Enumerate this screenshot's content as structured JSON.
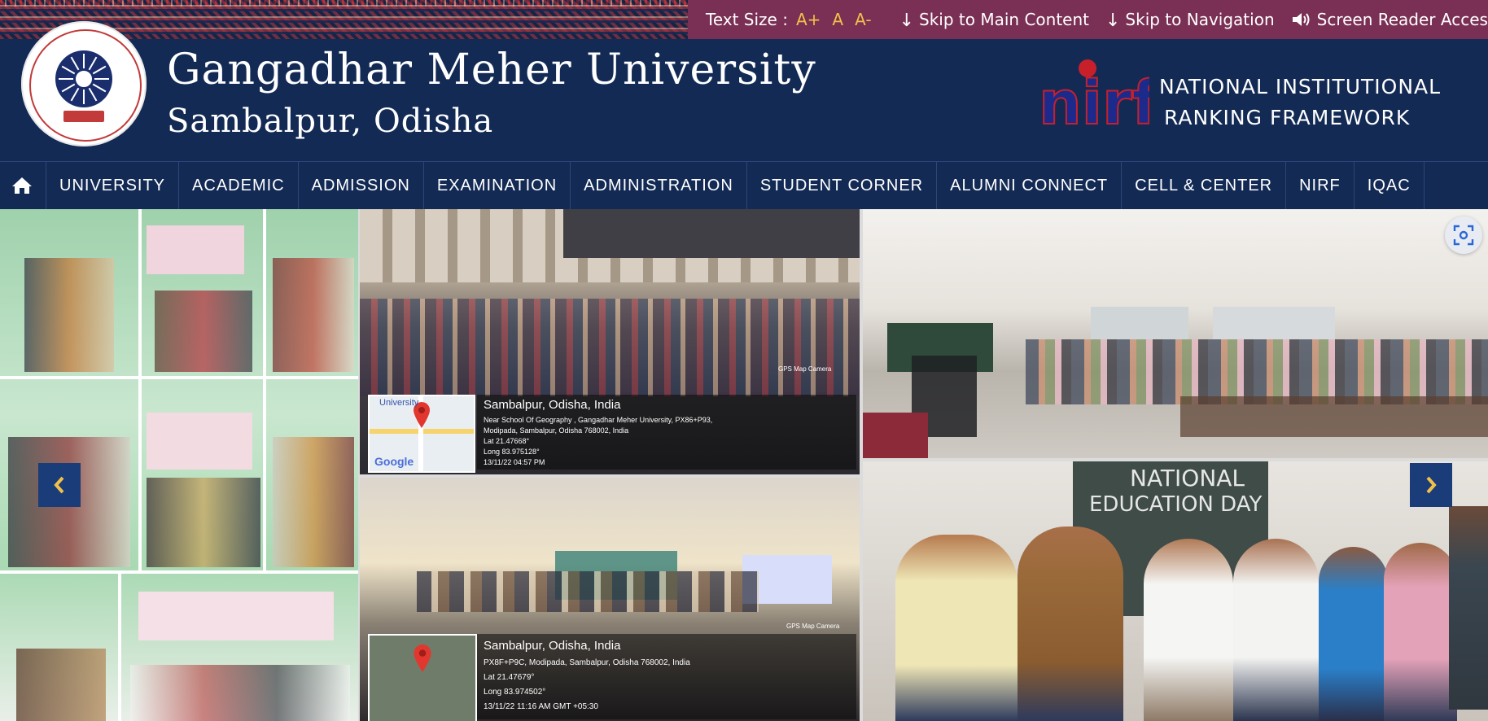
{
  "topbar": {
    "text_size_label": "Text Size :",
    "text_size_buttons": [
      "A+",
      "A",
      "A-"
    ],
    "skip_main": "Skip to Main Content",
    "skip_nav": "Skip to Navigation",
    "screen_reader": "Screen Reader Access"
  },
  "header": {
    "university_name": "Gangadhar Meher University",
    "location": "Sambalpur, Odisha",
    "nirf_line1": "NATIONAL INSTITUTIONAL",
    "nirf_line2": "RANKING FRAMEWORK",
    "nirf_logo_text": "nirf"
  },
  "nav": {
    "items": [
      "UNIVERSITY",
      "ACADEMIC",
      "ADMISSION",
      "EXAMINATION",
      "ADMINISTRATION",
      "STUDENT CORNER",
      "ALUMNI CONNECT",
      "CELL & CENTER",
      "NIRF",
      "IQAC"
    ]
  },
  "slider": {
    "geo_tag_1": {
      "city": "Sambalpur, Odisha, India",
      "addr1": "Near School Of Geography , Gangadhar Meher University, PX86+P93,",
      "addr2": "Modipada, Sambalpur, Odisha 768002, India",
      "lat": "Lat 21.47668°",
      "long": "Long 83.975128°",
      "time": "13/11/22 04:57 PM",
      "camera": "GPS Map Camera"
    },
    "geo_tag_2": {
      "city": "Sambalpur, Odisha, India",
      "addr1": "PX8F+P9C, Modipada, Sambalpur, Odisha 768002, India",
      "lat": "Lat 21.47679°",
      "long": "Long 83.974502°",
      "time": "13/11/22 11:16 AM GMT +05:30",
      "camera": "GPS Map Camera"
    },
    "board_text_line1": "NATIONAL",
    "board_text_line2": "EDUCATION DAY",
    "map_label": "University",
    "map_brand": "Google"
  },
  "colors": {
    "navy": "#132a55",
    "utility_bar": "#7a2f54",
    "text_size_accent": "#f2c14a",
    "nirf_red": "#c8202a",
    "slider_button": "#1a3c78"
  },
  "icons": {
    "home": "home-icon",
    "skip": "arrow-down-icon",
    "screen_reader": "speaker-icon",
    "prev": "chevron-left-icon",
    "next": "chevron-right-icon",
    "scan": "image-scan-icon"
  }
}
